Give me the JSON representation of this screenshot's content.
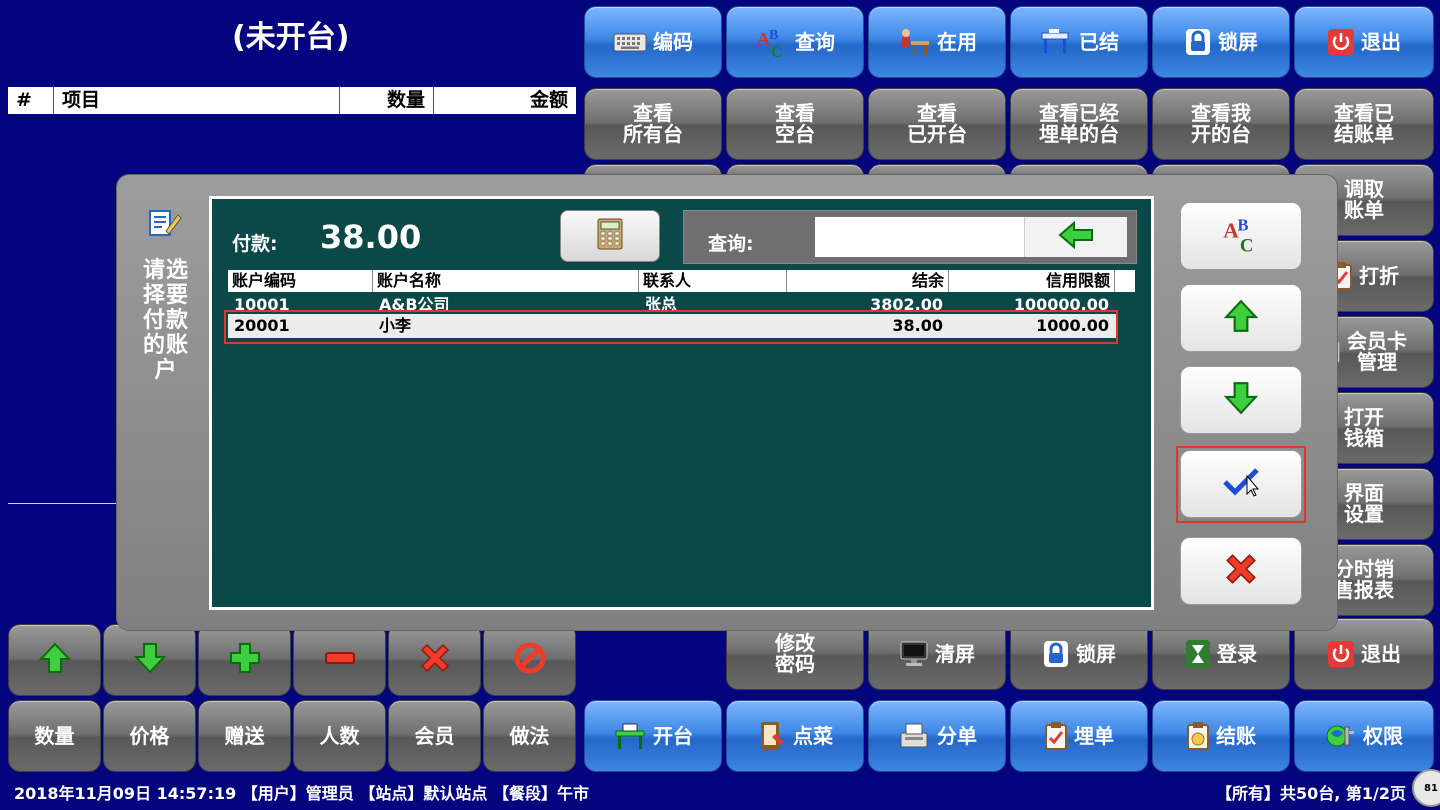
{
  "status_label": "(未开台)",
  "order_table": {
    "columns": [
      "#",
      "项目",
      "数量",
      "金额"
    ]
  },
  "top_row": [
    {
      "label": "编码",
      "icon": "keyboard-icon"
    },
    {
      "label": "查询",
      "icon": "abc-search-icon"
    },
    {
      "label": "在用",
      "icon": "occupied-table-icon"
    },
    {
      "label": "已结",
      "icon": "settled-table-icon"
    },
    {
      "label": "锁屏",
      "icon": "lock-icon"
    },
    {
      "label": "退出",
      "icon": "power-icon"
    }
  ],
  "second_row": [
    {
      "line1": "查看",
      "line2": "所有台"
    },
    {
      "line1": "查看",
      "line2": "空台"
    },
    {
      "line1": "查看",
      "line2": "已开台"
    },
    {
      "line1": "查看已经",
      "line2": "埋单的台"
    },
    {
      "line1": "查看我",
      "line2": "开的台"
    },
    {
      "line1": "查看已",
      "line2": "结账单"
    }
  ],
  "right_column": [
    {
      "line1": "调取",
      "line2": "账单"
    },
    {
      "label": "打折",
      "icon": "clipboard-check-icon"
    },
    {
      "line1": "会员卡",
      "line2": "管理",
      "icon": "member-card-icon"
    },
    {
      "line1": "打开",
      "line2": "钱箱"
    },
    {
      "line1": "界面",
      "line2": "设置"
    },
    {
      "line1": "分时销",
      "line2": "售报表"
    }
  ],
  "lower_function_row": [
    {
      "line1": "修改",
      "line2": "密码"
    },
    {
      "label": "清屏",
      "icon": "monitor-icon"
    },
    {
      "label": "锁屏",
      "icon": "lock-icon"
    },
    {
      "label": "登录",
      "icon": "hourglass-icon"
    },
    {
      "label": "退出",
      "icon": "power-icon"
    }
  ],
  "edit_buttons": [
    "up-arrow-icon",
    "down-arrow-icon",
    "plus-icon",
    "minus-icon",
    "delete-x-icon",
    "cancel-circle-icon"
  ],
  "bottom_left_buttons": [
    "数量",
    "价格",
    "赠送",
    "人数",
    "会员",
    "做法"
  ],
  "bottom_right_buttons": [
    {
      "label": "开台",
      "icon": "open-table-icon"
    },
    {
      "label": "点菜",
      "icon": "order-dish-icon"
    },
    {
      "label": "分单",
      "icon": "split-bill-icon"
    },
    {
      "label": "埋单",
      "icon": "bill-icon"
    },
    {
      "label": "结账",
      "icon": "checkout-icon"
    },
    {
      "label": "权限",
      "icon": "permission-icon"
    }
  ],
  "status_bar": {
    "left": "2018年11月09日 14:57:19 【用户】管理员 【站点】默认站点 【餐段】午市",
    "right": "【所有】共50台, 第1/2页",
    "page_badge": "81"
  },
  "modal": {
    "prompt": [
      "请选",
      "择要",
      "付款",
      "的账",
      "户"
    ],
    "pay_label": "付款:",
    "pay_amount": "38.00",
    "query_label": "查询:",
    "query_value": "",
    "columns": [
      "账户编码",
      "账户名称",
      "联系人",
      "结余",
      "信用限额"
    ],
    "rows": [
      {
        "code": "10001",
        "name": "A&B公司",
        "contact": "张总",
        "balance": "3802.00",
        "credit": "100000.00"
      },
      {
        "code": "20001",
        "name": "小李",
        "contact": "",
        "balance": "38.00",
        "credit": "1000.00"
      }
    ],
    "side_buttons": [
      "abc-search-icon",
      "up-arrow-icon",
      "down-arrow-icon",
      "confirm-check-icon",
      "cancel-x-icon"
    ]
  },
  "colors": {
    "background": "#03047e",
    "button_grey": "#6e6e6e",
    "button_blue": "#3d88e6",
    "modal_inner": "#0b4848",
    "highlight": "#e0362c"
  }
}
